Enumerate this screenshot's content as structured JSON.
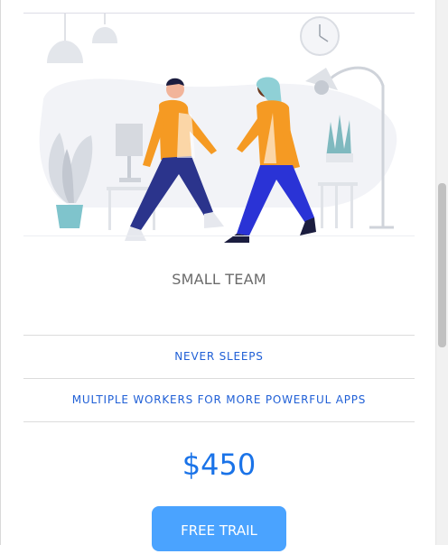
{
  "plan": {
    "name": "SMALL TEAM",
    "features": [
      "NEVER SLEEPS",
      "MULTIPLE WORKERS FOR MORE POWERFUL APPS"
    ],
    "price": "$450",
    "cta_label": "FREE TRAIL"
  },
  "colors": {
    "accent_blue": "#1a73e8",
    "feature_blue": "#1f5fd6",
    "button_blue": "#4aa3ff",
    "jacket_orange": "#f59a23",
    "plant_teal": "#7fc4cc"
  },
  "icons": [
    "pendant-lamp-icon",
    "wall-clock-icon",
    "floor-lamp-icon",
    "potted-plant-icon",
    "table-lamp-icon"
  ]
}
